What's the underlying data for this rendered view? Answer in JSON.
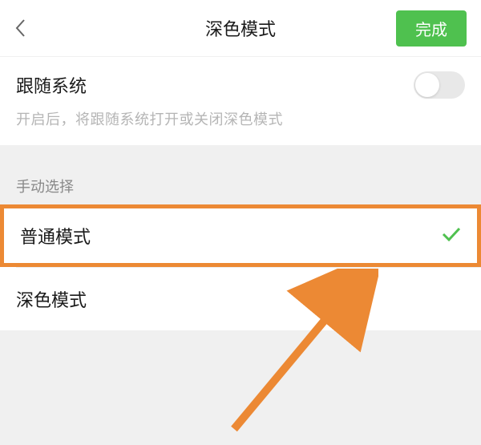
{
  "header": {
    "title": "深色模式",
    "done_label": "完成"
  },
  "follow_system": {
    "label": "跟随系统",
    "description": "开启后，将跟随系统打开或关闭深色模式",
    "enabled": false
  },
  "manual": {
    "section_label": "手动选择",
    "options": {
      "normal": "普通模式",
      "dark": "深色模式"
    },
    "selected": "normal"
  }
}
